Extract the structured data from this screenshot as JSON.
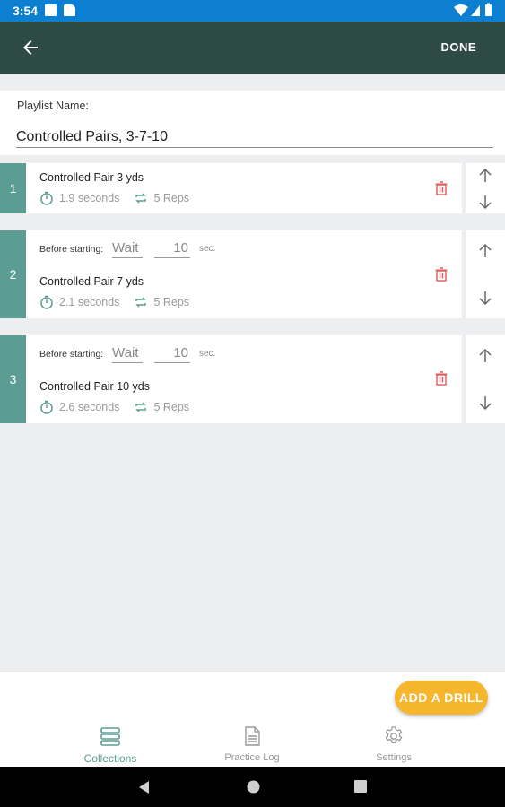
{
  "status_bar": {
    "time": "3:54"
  },
  "app_bar": {
    "done_label": "DONE"
  },
  "playlist": {
    "name_label": "Playlist Name:",
    "name_value": "Controlled Pairs, 3-7-10"
  },
  "drills": [
    {
      "number": "1",
      "name": "Controlled Pair 3 yds",
      "time": "1.9",
      "time_unit": "seconds",
      "reps": "5",
      "reps_unit": "Reps"
    },
    {
      "number": "2",
      "before_label": "Before starting:",
      "wait": "Wait",
      "wait_secs": "10",
      "sec_unit": "sec.",
      "name": "Controlled Pair 7 yds",
      "time": "2.1",
      "time_unit": "seconds",
      "reps": "5",
      "reps_unit": "Reps"
    },
    {
      "number": "3",
      "before_label": "Before starting:",
      "wait": "Wait",
      "wait_secs": "10",
      "sec_unit": "sec.",
      "name": "Controlled Pair 10 yds",
      "time": "2.6",
      "time_unit": "seconds",
      "reps": "5",
      "reps_unit": "Reps"
    }
  ],
  "fab": {
    "label": "ADD A DRILL"
  },
  "bottom_nav": [
    {
      "label": "Collections",
      "icon": "collections-icon",
      "active": true
    },
    {
      "label": "Practice Log",
      "icon": "document-icon",
      "active": false
    },
    {
      "label": "Settings",
      "icon": "gear-icon",
      "active": false
    }
  ],
  "colors": {
    "app_bar": "#2e4a45",
    "accent": "#5b9d93",
    "fab": "#f5b52c",
    "delete": "#e05a5a",
    "status_bar": "#0c7fd0"
  }
}
